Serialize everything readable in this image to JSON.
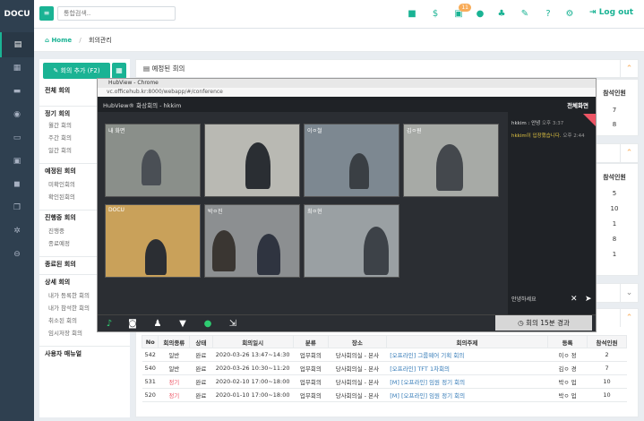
{
  "brand": "DOCU",
  "search": {
    "placeholder": "통합검색.."
  },
  "topbar": {
    "badge_count": "11",
    "logout": "Log out"
  },
  "breadcrumb": {
    "home": "Home",
    "current": "회의관리"
  },
  "left": {
    "add_button": "회의 추가 (F2)",
    "nav": [
      {
        "label": "전체 회의",
        "type": "head"
      },
      {
        "label": "정기 회의",
        "type": "head"
      },
      {
        "label": "월간 회의",
        "type": "sub"
      },
      {
        "label": "주간 회의",
        "type": "sub"
      },
      {
        "label": "일간 회의",
        "type": "sub"
      },
      {
        "label": "예정된 회의",
        "type": "head"
      },
      {
        "label": "미확인회의",
        "type": "sub"
      },
      {
        "label": "확인된회의",
        "type": "sub"
      },
      {
        "label": "진행중 회의",
        "type": "head"
      },
      {
        "label": "진행중",
        "type": "sub"
      },
      {
        "label": "종료예정",
        "type": "sub"
      },
      {
        "label": "종료된 회의",
        "type": "head"
      },
      {
        "label": "상세 회의",
        "type": "head"
      },
      {
        "label": "내가 등록한 회의",
        "type": "sub"
      },
      {
        "label": "내가 참석한 회의",
        "type": "sub"
      },
      {
        "label": "취소된 회의",
        "type": "sub"
      },
      {
        "label": "임시저장 회의",
        "type": "sub"
      },
      {
        "label": "사용자 매뉴얼",
        "type": "head"
      }
    ]
  },
  "panels": {
    "scheduled_title": "예정된 회의",
    "attendees_header": "참석인원",
    "scheduled_counts": [
      "7",
      "8"
    ],
    "second_counts": [
      "5",
      "10",
      "1",
      "8",
      "1"
    ]
  },
  "table": {
    "headers": [
      "No",
      "회의종류",
      "상태",
      "회의일시",
      "분류",
      "장소",
      "회의주제",
      "등록",
      "참석인원"
    ],
    "rows": [
      [
        "542",
        "일반",
        "완료",
        "2020-03-26 13:47~14:30",
        "업무회의",
        "당사회의실 - 본사",
        "[오프라인] 그룹웨어 기획 회의",
        "이ㅇ 정",
        "2"
      ],
      [
        "540",
        "일반",
        "완료",
        "2020-03-26 10:30~11:20",
        "업무회의",
        "당사회의실 - 본사",
        "[오프라인] TFT 1차회의",
        "김ㅇ 경",
        "7"
      ],
      [
        "531",
        "정기",
        "완료",
        "2020-02-10 17:00~18:00",
        "업무회의",
        "당사회의실 - 본사",
        "[M] [오프라인] 임원 정기 회의",
        "박ㅇ 업",
        "10"
      ],
      [
        "520",
        "정기",
        "완료",
        "2020-01-10 17:00~18:00",
        "업무회의",
        "당사회의실 - 본사",
        "[M] [오프라인] 임원 정기 회의",
        "박ㅇ 업",
        "10"
      ]
    ]
  },
  "video": {
    "window_title": "HubView - Chrome",
    "address": "vc.officehub.kr:8000/webapp/#/conference",
    "header_title": "HubView® 화상회의 - hkkim",
    "fullscreen": "전체화면",
    "tiles": [
      {
        "label": "내 화면"
      },
      {
        "label": ""
      },
      {
        "label": "이ㅇ철"
      },
      {
        "label": "김ㅇ원"
      },
      {
        "label": "DOCU"
      },
      {
        "label": "박ㅇ진"
      },
      {
        "label": "최ㅇ현"
      }
    ],
    "chat": {
      "msg1_user": "hkkim : 안녕",
      "msg1_time": "오후 3:37",
      "msg2": "hkkim이 입장했습니다.",
      "msg2_time": "오후 2:44",
      "input": "안녕하세요"
    },
    "timer": "회의 15분 경과"
  },
  "colors": {
    "accent": "#1ab394",
    "sidebar": "#2f4050",
    "warning": "#f8ac59",
    "danger": "#ed5565"
  }
}
